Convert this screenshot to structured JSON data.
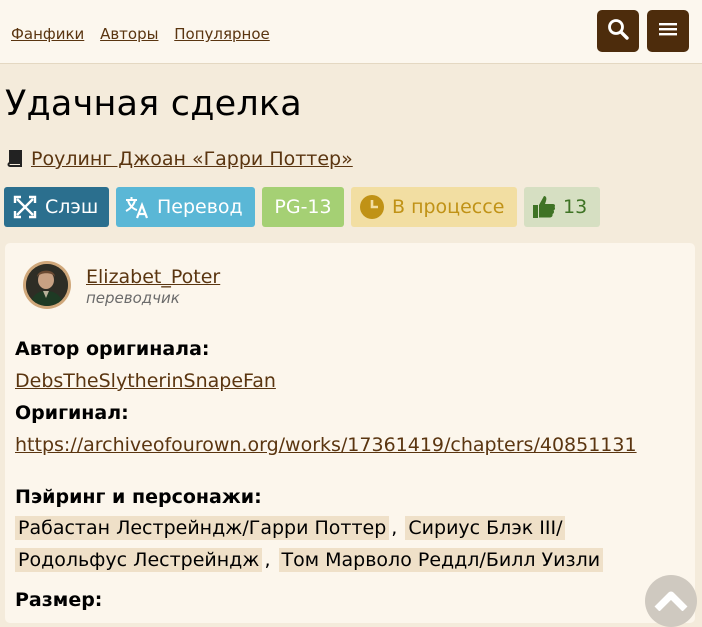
{
  "nav": {
    "items": [
      "Фанфики",
      "Авторы",
      "Популярное"
    ]
  },
  "icons": {
    "search": "search-icon",
    "menu": "menu-icon",
    "book": "book-icon",
    "slash": "slash-cross-icon",
    "translate": "translate-icon",
    "clock": "clock-icon",
    "like": "thumbs-up-icon",
    "scroll_up": "chevron-up-icon"
  },
  "colors": {
    "topbar_button": "#4d2c0c",
    "link": "#5a3510",
    "slash": "#2b6f8e",
    "translation": "#5ab7d6",
    "rating": "#a5d074",
    "status": "#f2dea2",
    "likes": "#d6dfc2"
  },
  "title": "Удачная сделка",
  "fandom": "Роулинг Джоан «Гарри Поттер»",
  "badges": {
    "direction": "Слэш",
    "type": "Перевод",
    "rating": "PG-13",
    "status": "В процессе",
    "likes": "13"
  },
  "translator": {
    "name": "Elizabet_Poter",
    "role": "переводчик"
  },
  "original_author": {
    "label": "Автор оригинала:",
    "value": "DebsTheSlytherinSnapeFan"
  },
  "original": {
    "label": "Оригинал:",
    "value": "https://archiveofourown.org/works/17361419/chapters/40851131"
  },
  "pairings": {
    "label": "Пэйринг и персонажи:",
    "items": [
      "Рабастан Лестрейндж/Гарри Поттер",
      "Сириус Блэк III/",
      "Родольфус Лестрейндж",
      "Том Марволо Реддл/Билл Уизли"
    ],
    "separator": ","
  },
  "size": {
    "label": "Размер:"
  }
}
